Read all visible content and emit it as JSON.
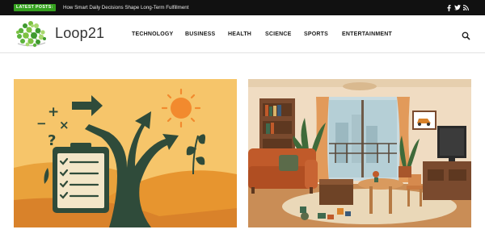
{
  "topbar": {
    "badge_label": "LATEST POSTS:",
    "ticker_text": "How Smart Daily Decisions Shape Long-Term Fulfillment",
    "social_icons": [
      "facebook-icon",
      "twitter-icon",
      "rss-icon"
    ]
  },
  "header": {
    "site_title": "Loop21",
    "logo_colors": [
      "#7cc242",
      "#3f9a2e",
      "#a8d86e",
      "#5cb33c"
    ]
  },
  "nav": {
    "items": [
      {
        "label": "TECHNOLOGY"
      },
      {
        "label": "BUSINESS"
      },
      {
        "label": "HEALTH"
      },
      {
        "label": "SCIENCE"
      },
      {
        "label": "SPORTS"
      },
      {
        "label": "ENTERTAINMENT"
      }
    ],
    "search_icon": "search-icon"
  },
  "articles": [
    {
      "image": "decision-path-illustration",
      "palette": [
        "#f6c56a",
        "#e7952f",
        "#2f4b3a",
        "#f28a2e"
      ]
    },
    {
      "image": "living-room-illustration",
      "palette": [
        "#f0dcc2",
        "#c05a2a",
        "#7a4a2e",
        "#e9c9a0"
      ]
    }
  ]
}
